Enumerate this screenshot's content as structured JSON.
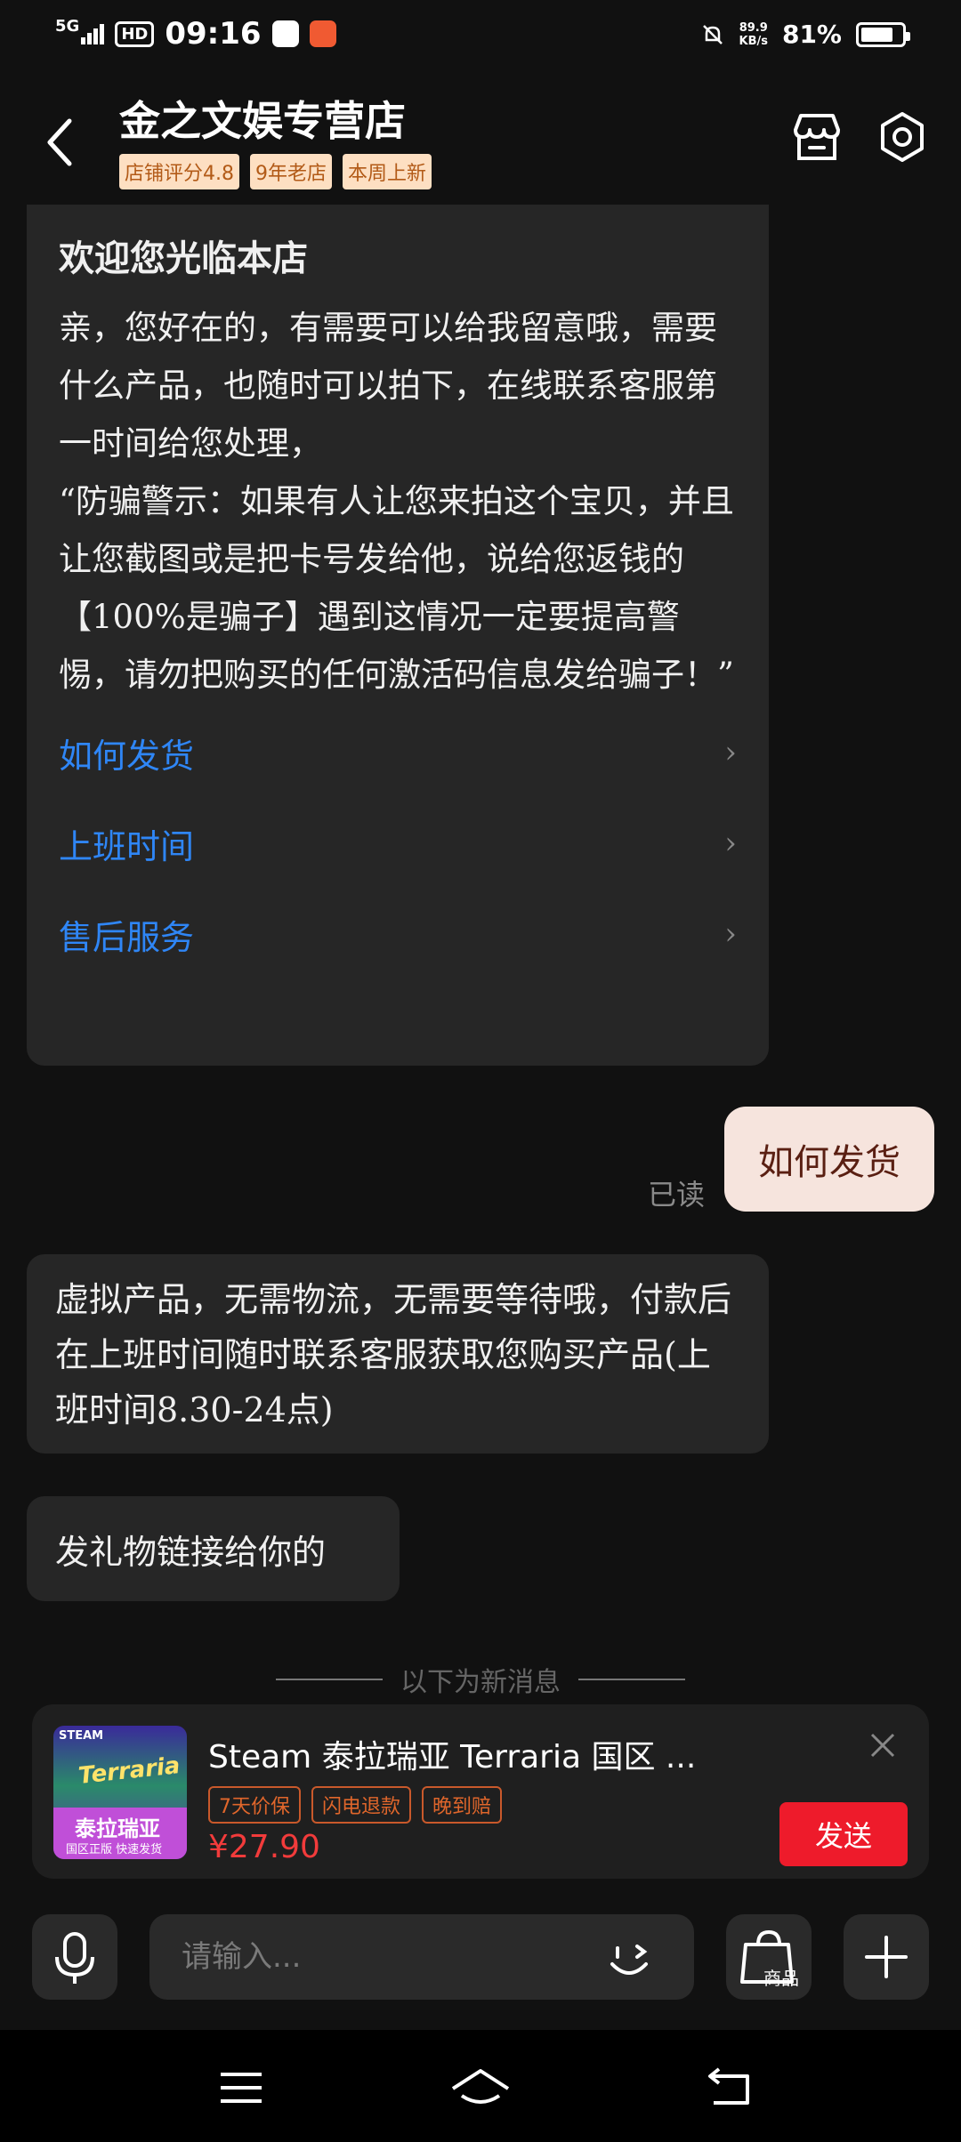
{
  "status_bar": {
    "network": "5G",
    "hd": "HD",
    "time": "09:16",
    "speed_value": "89.9",
    "speed_unit": "KB/s",
    "battery": "81%",
    "battery_level": 0.81
  },
  "header": {
    "shop_name": "金之文娱专营店",
    "tags": [
      "店铺评分4.8",
      "9年老店",
      "本周上新"
    ]
  },
  "welcome_card": {
    "title": "欢迎您光临本店",
    "body": "亲，您好在的，有需要可以给我留意哦，需要什么产品，也随时可以拍下，在线联系客服第一时间给您处理，\n“防骗警示：如果有人让您来拍这个宝贝，并且让您截图或是把卡号发给他，说给您返钱的【100%是骗子】遇到这情况一定要提高警惕，请勿把购买的任何激活码信息发给骗子！”",
    "faq": [
      "如何发货",
      "上班时间",
      "售后服务"
    ]
  },
  "messages": {
    "user_message": "如何发货",
    "read_status": "已读",
    "reply_1": "虚拟产品，无需物流，无需要等待哦，付款后在上班时间随时联系客服获取您购买产品(上班时间8.30-24点)",
    "reply_2": "发礼物链接给你的"
  },
  "divider_text": "以下为新消息",
  "product": {
    "thumb_steam": "STEAM",
    "thumb_logo": "Terraria",
    "thumb_title": "泰拉瑞亚",
    "thumb_subtitle": "国区正版   快速发货",
    "title": "Steam 泰拉瑞亚 Terraria 国区 ...",
    "guarantees": [
      "7天价保",
      "闪电退款",
      "晚到赔"
    ],
    "price": "¥27.90",
    "send_label": "发送"
  },
  "input": {
    "placeholder": "请输入...",
    "goods_label": "商品"
  },
  "colors": {
    "link": "#2f86f6",
    "accent_red": "#ee1b2b",
    "tag_bg": "#fddfc2",
    "user_bubble": "#f6e4dd"
  }
}
